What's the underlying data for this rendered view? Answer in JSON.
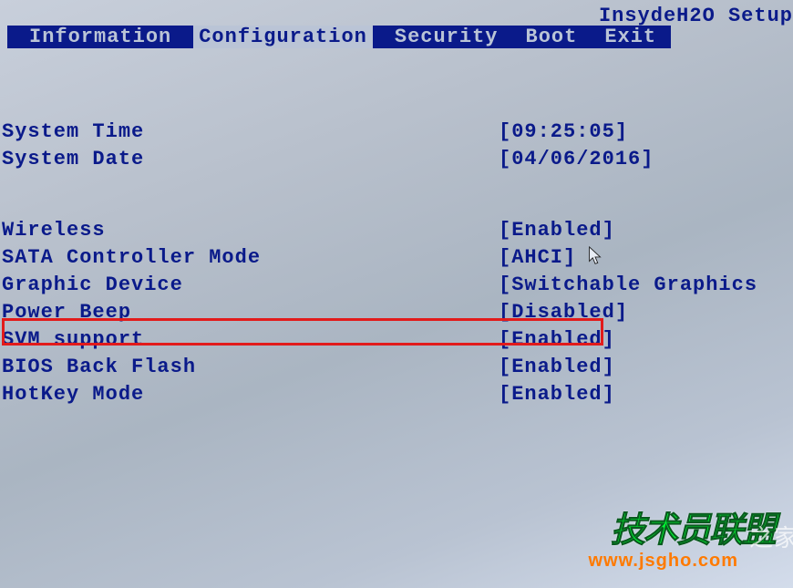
{
  "header": {
    "title": "InsydeH2O Setup"
  },
  "tabs": [
    {
      "label": "Information",
      "active": false
    },
    {
      "label": "Configuration",
      "active": true
    },
    {
      "label": "Security",
      "active": false
    },
    {
      "label": "Boot",
      "active": false
    },
    {
      "label": "Exit",
      "active": false
    }
  ],
  "settings": {
    "system_time": {
      "label": "System Time",
      "value": "[09:25:05]"
    },
    "system_date": {
      "label": "System Date",
      "value": "[04/06/2016]"
    },
    "wireless": {
      "label": "Wireless",
      "value": "[Enabled]"
    },
    "sata_mode": {
      "label": "SATA Controller Mode",
      "value": "[AHCI]"
    },
    "graphic_device": {
      "label": "Graphic Device",
      "value": "[Switchable Graphics"
    },
    "power_beep": {
      "label": "Power Beep",
      "value": "[Disabled]"
    },
    "svm_support": {
      "label": "SVM support",
      "value": "[Enabled]"
    },
    "bios_back_flash": {
      "label": "BIOS Back Flash",
      "value": "[Enabled]"
    },
    "hotkey_mode": {
      "label": "HotKey Mode",
      "value": "[Enabled]"
    }
  },
  "watermark": {
    "text1": "技术员联盟",
    "text2": "www.jsgho.com",
    "text3": "之家"
  }
}
